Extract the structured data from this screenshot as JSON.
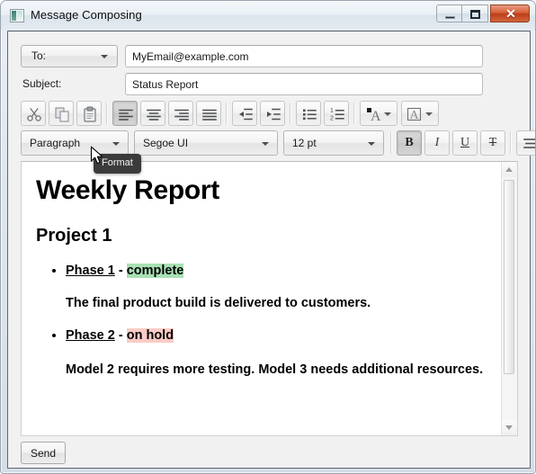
{
  "window": {
    "title": "Message Composing",
    "icon": "app-icon",
    "controls": {
      "minimize": "minimize-icon",
      "maximize": "maximize-icon",
      "close_glyph": "✕"
    }
  },
  "header": {
    "recipient_type": "To:",
    "recipient_value": "MyEmail@example.com",
    "recipient_placeholder": "",
    "subject_label": "Subject:",
    "subject_value": "Status Report",
    "subject_placeholder": ""
  },
  "toolbar_row1": {
    "buttons": [
      {
        "name": "cut-button",
        "icon": "scissors-icon",
        "tooltip": "Cut",
        "active": false
      },
      {
        "name": "copy-button",
        "icon": "copy-icon",
        "tooltip": "Copy",
        "active": false
      },
      {
        "name": "paste-button",
        "icon": "clipboard-icon",
        "tooltip": "Paste",
        "active": false
      },
      {
        "name": "align-left-button",
        "icon": "align-left-icon",
        "tooltip": "Align Left",
        "active": true
      },
      {
        "name": "align-center-button",
        "icon": "align-center-icon",
        "tooltip": "Align Center",
        "active": false
      },
      {
        "name": "align-right-button",
        "icon": "align-right-icon",
        "tooltip": "Align Right",
        "active": false
      },
      {
        "name": "align-justify-button",
        "icon": "align-justify-icon",
        "tooltip": "Justify",
        "active": false
      },
      {
        "name": "decrease-indent-button",
        "icon": "decrease-indent-icon",
        "tooltip": "Decrease Indent",
        "active": false
      },
      {
        "name": "increase-indent-button",
        "icon": "increase-indent-icon",
        "tooltip": "Increase Indent",
        "active": false
      },
      {
        "name": "bullet-list-button",
        "icon": "bullet-list-icon",
        "tooltip": "Bullets",
        "active": false
      },
      {
        "name": "numbered-list-button",
        "icon": "numbered-list-icon",
        "tooltip": "Numbering",
        "active": false
      },
      {
        "name": "font-color-button",
        "icon": "font-color-icon",
        "tooltip": "Font Color",
        "active": false
      },
      {
        "name": "highlight-color-button",
        "icon": "highlight-color-icon",
        "tooltip": "Highlight",
        "active": false
      }
    ]
  },
  "toolbar_row2": {
    "format_value": "Paragraph",
    "font_value": "Segoe UI",
    "size_value": "12 pt",
    "bold_label": "B",
    "italic_label": "I",
    "underline_label": "U",
    "strikethrough_label": "T",
    "line_spacing_icon": "line-spacing-icon",
    "bold_active": true
  },
  "tooltip": {
    "text": "Format"
  },
  "document": {
    "title": "Weekly Report",
    "section": "Project 1",
    "items": [
      {
        "name": "Phase 1",
        "dash": " - ",
        "status": "complete",
        "status_highlight": "#a8e0b4",
        "body": "The final product build is delivered to customers."
      },
      {
        "name": "Phase 2",
        "dash": " - ",
        "status": "on hold",
        "status_highlight": "#fbccc7",
        "body": "Model 2 requires more testing. Model 3 needs additional resources."
      }
    ]
  },
  "scrollbar": {
    "up_icon": "scroll-up-icon",
    "down_icon": "scroll-down-icon",
    "thumb": "scroll-thumb"
  },
  "footer": {
    "send_label": "Send"
  },
  "colors": {
    "accent_close": "#bd3f17",
    "highlight_green": "#a8e0b4",
    "highlight_red": "#fbccc7",
    "client_bg": "#f1f1f1"
  }
}
